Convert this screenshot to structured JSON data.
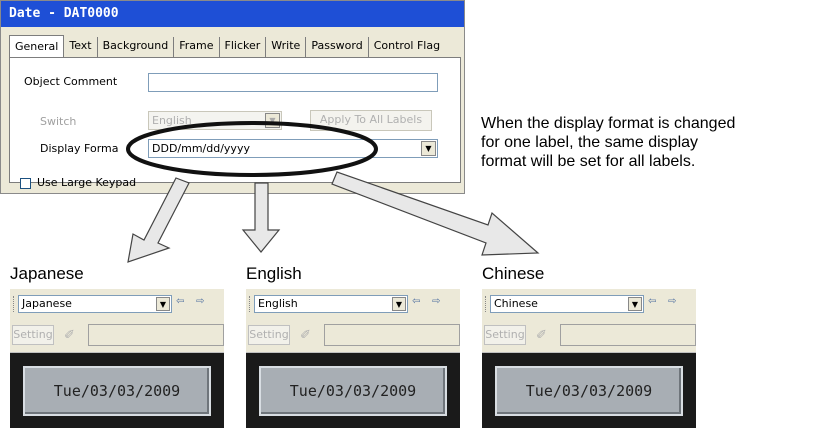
{
  "dialog": {
    "title": "Date - DAT0000",
    "tabs": [
      "General",
      "Text",
      "Background",
      "Frame",
      "Flicker",
      "Write",
      "Password",
      "Control Flag"
    ],
    "object_comment_label": "Object Comment",
    "object_comment_value": "",
    "switch_label": "Switch",
    "switch_value": "English",
    "apply_button": "Apply To All Labels",
    "display_format_label": "Display Forma",
    "display_format_value": "DDD/mm/dd/yyyy",
    "use_large_keypad_label": "Use Large Keypad",
    "use_large_keypad_checked": false
  },
  "note": {
    "line1": "When the display format is changed",
    "line2": "for one label, the same display",
    "line3": "format will be set for all labels."
  },
  "panels": [
    {
      "heading": "Japanese",
      "select_value": "Japanese",
      "setting_label": "Setting",
      "display_value": "Tue/03/03/2009"
    },
    {
      "heading": "English",
      "select_value": "English",
      "setting_label": "Setting",
      "display_value": "Tue/03/03/2009"
    },
    {
      "heading": "Chinese",
      "select_value": "Chinese",
      "setting_label": "Setting",
      "display_value": "Tue/03/03/2009"
    }
  ],
  "icons": [
    "dropdown-arrow-icon",
    "label-prev-icon",
    "label-next-icon",
    "pen-icon",
    "arrow-icon"
  ]
}
